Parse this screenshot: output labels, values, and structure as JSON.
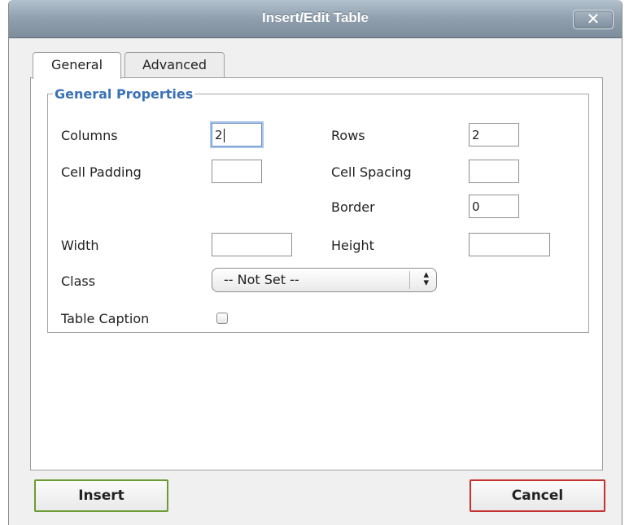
{
  "dialog": {
    "title": "Insert/Edit Table",
    "close_symbol": "✕"
  },
  "tabs": [
    {
      "label": "General",
      "active": true
    },
    {
      "label": "Advanced",
      "active": false
    }
  ],
  "general_properties": {
    "legend": "General Properties",
    "columns": {
      "label": "Columns",
      "value": "2"
    },
    "rows": {
      "label": "Rows",
      "value": "2"
    },
    "cell_padding": {
      "label": "Cell Padding",
      "value": ""
    },
    "cell_spacing": {
      "label": "Cell Spacing",
      "value": ""
    },
    "border": {
      "label": "Border",
      "value": "0"
    },
    "width": {
      "label": "Width",
      "value": ""
    },
    "height": {
      "label": "Height",
      "value": ""
    },
    "class": {
      "label": "Class",
      "selected": "-- Not Set --"
    },
    "table_caption": {
      "label": "Table Caption",
      "checked": false
    }
  },
  "buttons": {
    "insert": "Insert",
    "cancel": "Cancel"
  },
  "colors": {
    "titlebar": "#8f9fad",
    "legend": "#3a70b5",
    "insert_border": "#6b9b34",
    "cancel_border": "#c4312f"
  },
  "icons": {
    "close": "close-icon",
    "select_arrows": "up-down-arrows-icon"
  }
}
